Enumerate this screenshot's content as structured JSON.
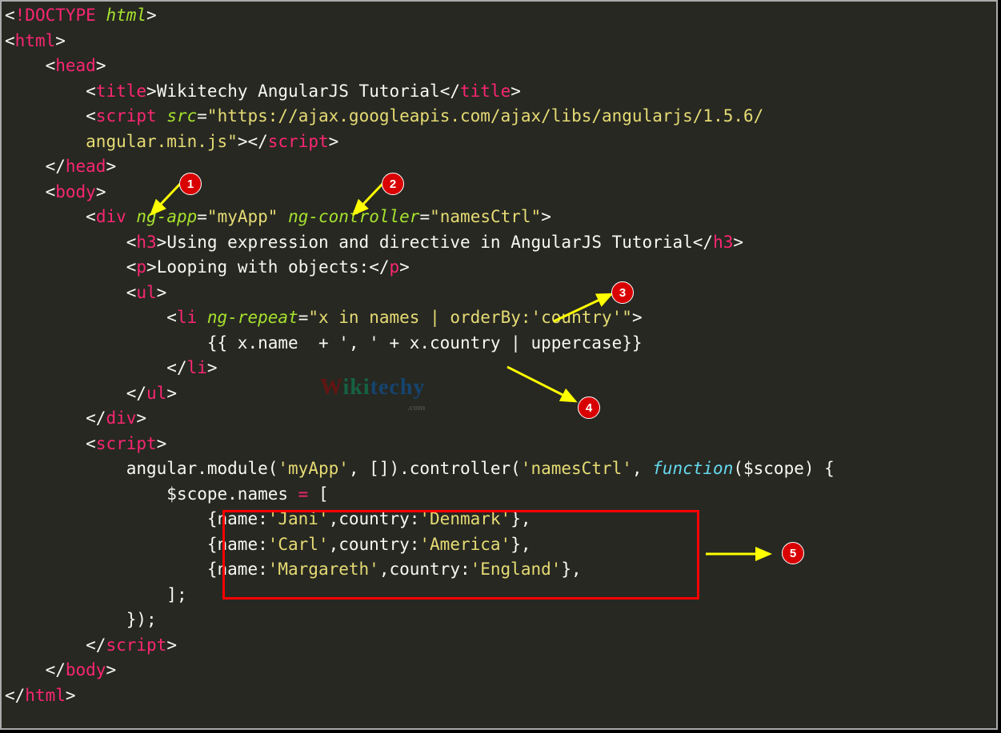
{
  "code": {
    "doctype_open": "<",
    "doctype_bang": "!DOCTYPE",
    "doctype_html": "html",
    "close": ">",
    "html": "html",
    "head": "head",
    "title": "title",
    "title_text": "Wikitechy AngularJS Tutorial",
    "script": "script",
    "src_attr": "src",
    "src_val1": "\"https://ajax.googleapis.com/ajax/libs/angularjs/1.5.6/",
    "src_val2": "angular.min.js\"",
    "body": "body",
    "div": "div",
    "ngapp": "ng-app",
    "ngapp_val": "\"myApp\"",
    "ngctrl": "ng-controller",
    "ngctrl_val": "\"namesCtrl\"",
    "h3": "h3",
    "h3_text": "Using expression and directive in AngularJS Tutorial",
    "p": "p",
    "p_text": "Looping with objects:",
    "ul": "ul",
    "li": "li",
    "ngrepeat": "ng-repeat",
    "ngrepeat_val": "\"x in names | orderBy:'country'\"",
    "expr": "{{ x.name  + ', ' + x.country | uppercase}}",
    "angular_line": "angular.module(",
    "myapp_str": "'myApp'",
    "arr": ", []).controller(",
    "namesctrl_str": "'namesCtrl'",
    "comma_sp": ", ",
    "function": "function",
    "params": "($scope) {",
    "scope_names": "$scope.names ",
    "equals": "=",
    "bracket_open": " [",
    "obj1a": "{name:",
    "jani": "'Jani'",
    "obj1b": ",country:",
    "denmark": "'Denmark'",
    "obj_close": "},",
    "carl": "'Carl'",
    "america": "'America'",
    "marg": "'Margareth'",
    "england": "'England'",
    "bracket_close": "];",
    "fn_close": "});"
  },
  "badges": {
    "b1": "1",
    "b2": "2",
    "b3": "3",
    "b4": "4",
    "b5": "5"
  },
  "watermark": {
    "w": "W",
    "iki": "iki",
    "techy": "techy",
    "dot": ".com"
  }
}
